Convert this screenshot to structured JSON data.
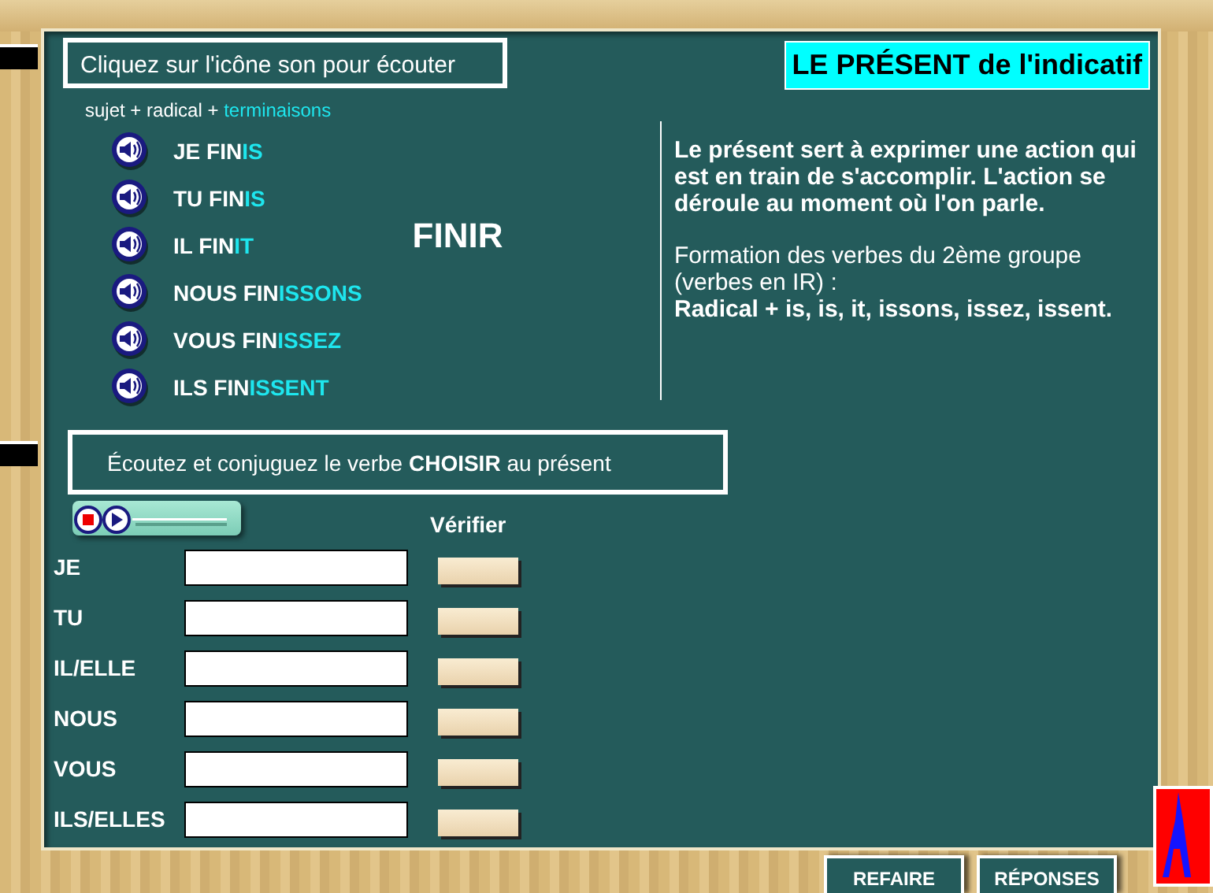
{
  "instruction": "Cliquez sur l'icône son pour écouter",
  "formula": [
    {
      "text": "sujet + radical + ",
      "highlight": false
    },
    {
      "text": "terminaisons",
      "highlight": true
    }
  ],
  "conjugations": [
    {
      "stem": "JE FIN",
      "ending": "IS"
    },
    {
      "stem": "TU FIN",
      "ending": "IS"
    },
    {
      "stem": "IL FIN",
      "ending": "IT"
    },
    {
      "stem": "NOUS FIN",
      "ending": "ISSONS"
    },
    {
      "stem": "VOUS FIN",
      "ending": "ISSEZ"
    },
    {
      "stem": "ILS FIN",
      "ending": "ISSENT"
    }
  ],
  "verb": "FINIR",
  "title": "LE PRÉSENT de l'indicatif",
  "explanation": [
    {
      "text": "Le présent sert à exprimer une action qui est en train de s'accomplir. L'action se déroule au moment où l'on parle.",
      "bold": true
    },
    {
      "text": "Formation des verbes du 2ème groupe (verbes en IR) :",
      "bold": false
    },
    {
      "text": "Radical + is, is, it, issons, issez, issent.",
      "bold": true
    }
  ],
  "exercise": {
    "instruction": "Écoutez et conjuguez le verbe **CHOISIR** au présent",
    "check_header": "Vérifier",
    "rows": [
      {
        "pronoun": "JE"
      },
      {
        "pronoun": "TU"
      },
      {
        "pronoun": "IL/ELLE"
      },
      {
        "pronoun": "NOUS"
      },
      {
        "pronoun": "VOUS"
      },
      {
        "pronoun": "ILS/ELLES"
      }
    ]
  },
  "buttons": [
    "REFAIRE",
    "RÉPONSES"
  ]
}
